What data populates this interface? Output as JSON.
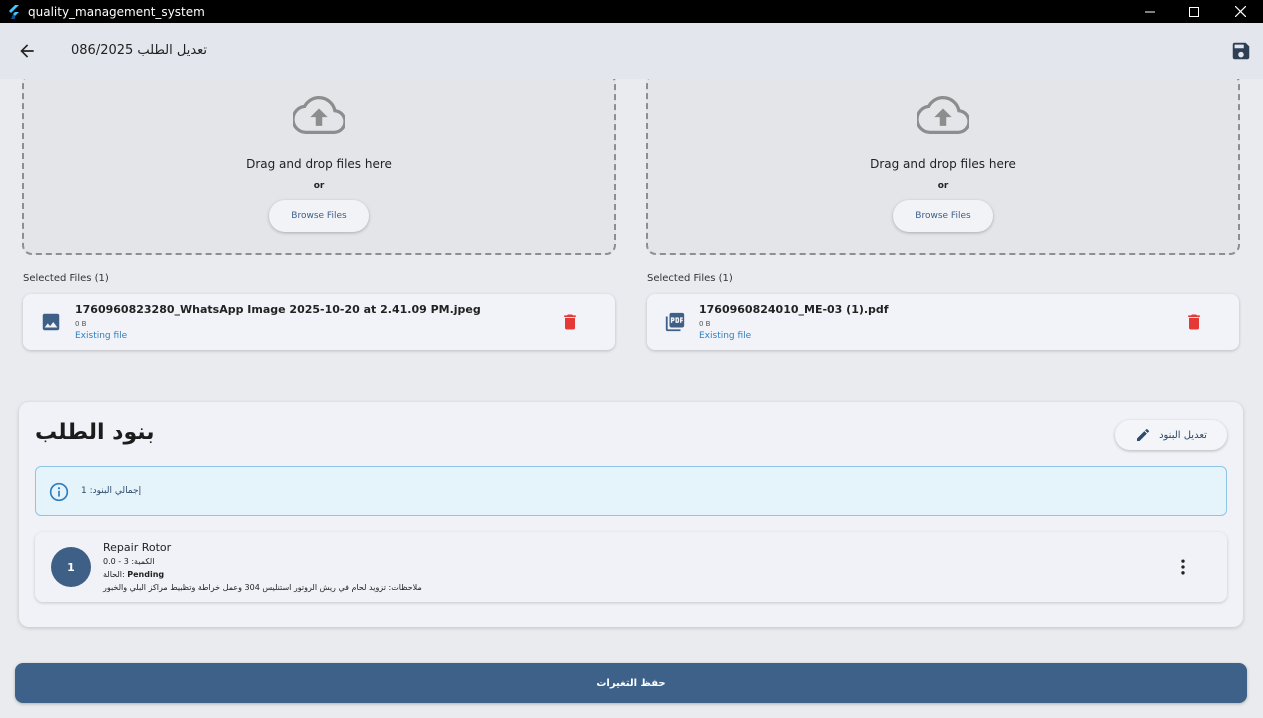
{
  "window": {
    "title": "quality_management_system",
    "controls": {
      "minimize": "—",
      "maximize": "☐",
      "close": "✕"
    }
  },
  "appbar": {
    "title": "تعديل الطلب 086/2025",
    "back_icon": "arrow-back-icon",
    "save_icon": "save-icon"
  },
  "uploads": [
    {
      "dropzone": {
        "text": "Drag and drop files here",
        "or": "or",
        "browse": "Browse Files"
      },
      "selected_label": "Selected Files (1)",
      "file": {
        "name": "1760960823280_WhatsApp Image 2025-10-20 at 2.41.09 PM.jpeg",
        "size": "0 B",
        "status": "Existing file",
        "icon": "image-icon"
      }
    },
    {
      "dropzone": {
        "text": "Drag and drop files here",
        "or": "or",
        "browse": "Browse Files"
      },
      "selected_label": "Selected Files (1)",
      "file": {
        "name": "1760960824010_ME-03 (1).pdf",
        "size": "0 B",
        "status": "Existing file",
        "icon": "pdf-icon"
      }
    }
  ],
  "items_section": {
    "title": "بنود الطلب",
    "edit_button": "تعديل البنود",
    "info_text": "إجمالي البنود: 1",
    "items": [
      {
        "number": "1",
        "name": "Repair Rotor",
        "quantity": "الكمية: 3 - 0.0",
        "status_label": "الحالة: ",
        "status_value": "Pending",
        "notes": "ملاحظات: تزويد لحام في ريش الروتور استنليس 304 وعمل خراطة وتظبيط مراكز البلي والخبور"
      }
    ]
  },
  "save_button": "حفظ التغيرات",
  "colors": {
    "primary": "#3e6189",
    "delete": "#e53935",
    "link": "#2f7fc0",
    "info_border": "#8ec5e6"
  }
}
